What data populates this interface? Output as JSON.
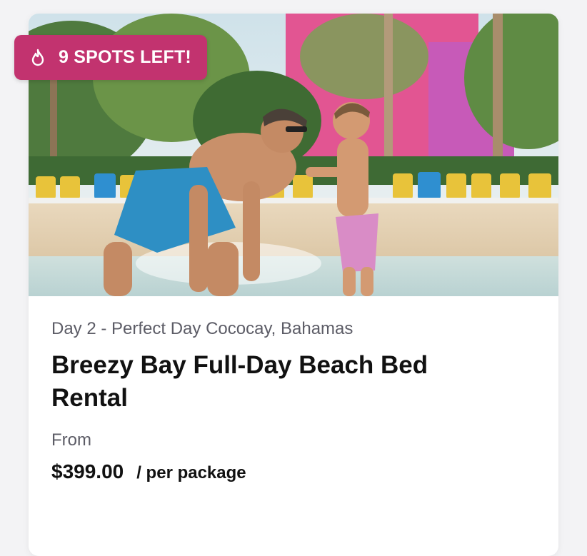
{
  "badge": {
    "icon": "flame-icon",
    "text": "9 SPOTS LEFT!",
    "color": "#c2336f"
  },
  "hero_image": {
    "description_icon": "beach-photo"
  },
  "excursion": {
    "day_location": "Day 2 - Perfect Day Cococay, Bahamas",
    "title": "Breezy Bay Full-Day Beach Bed Rental",
    "from_label": "From",
    "price": "$399.00",
    "price_unit": "/ per package"
  }
}
